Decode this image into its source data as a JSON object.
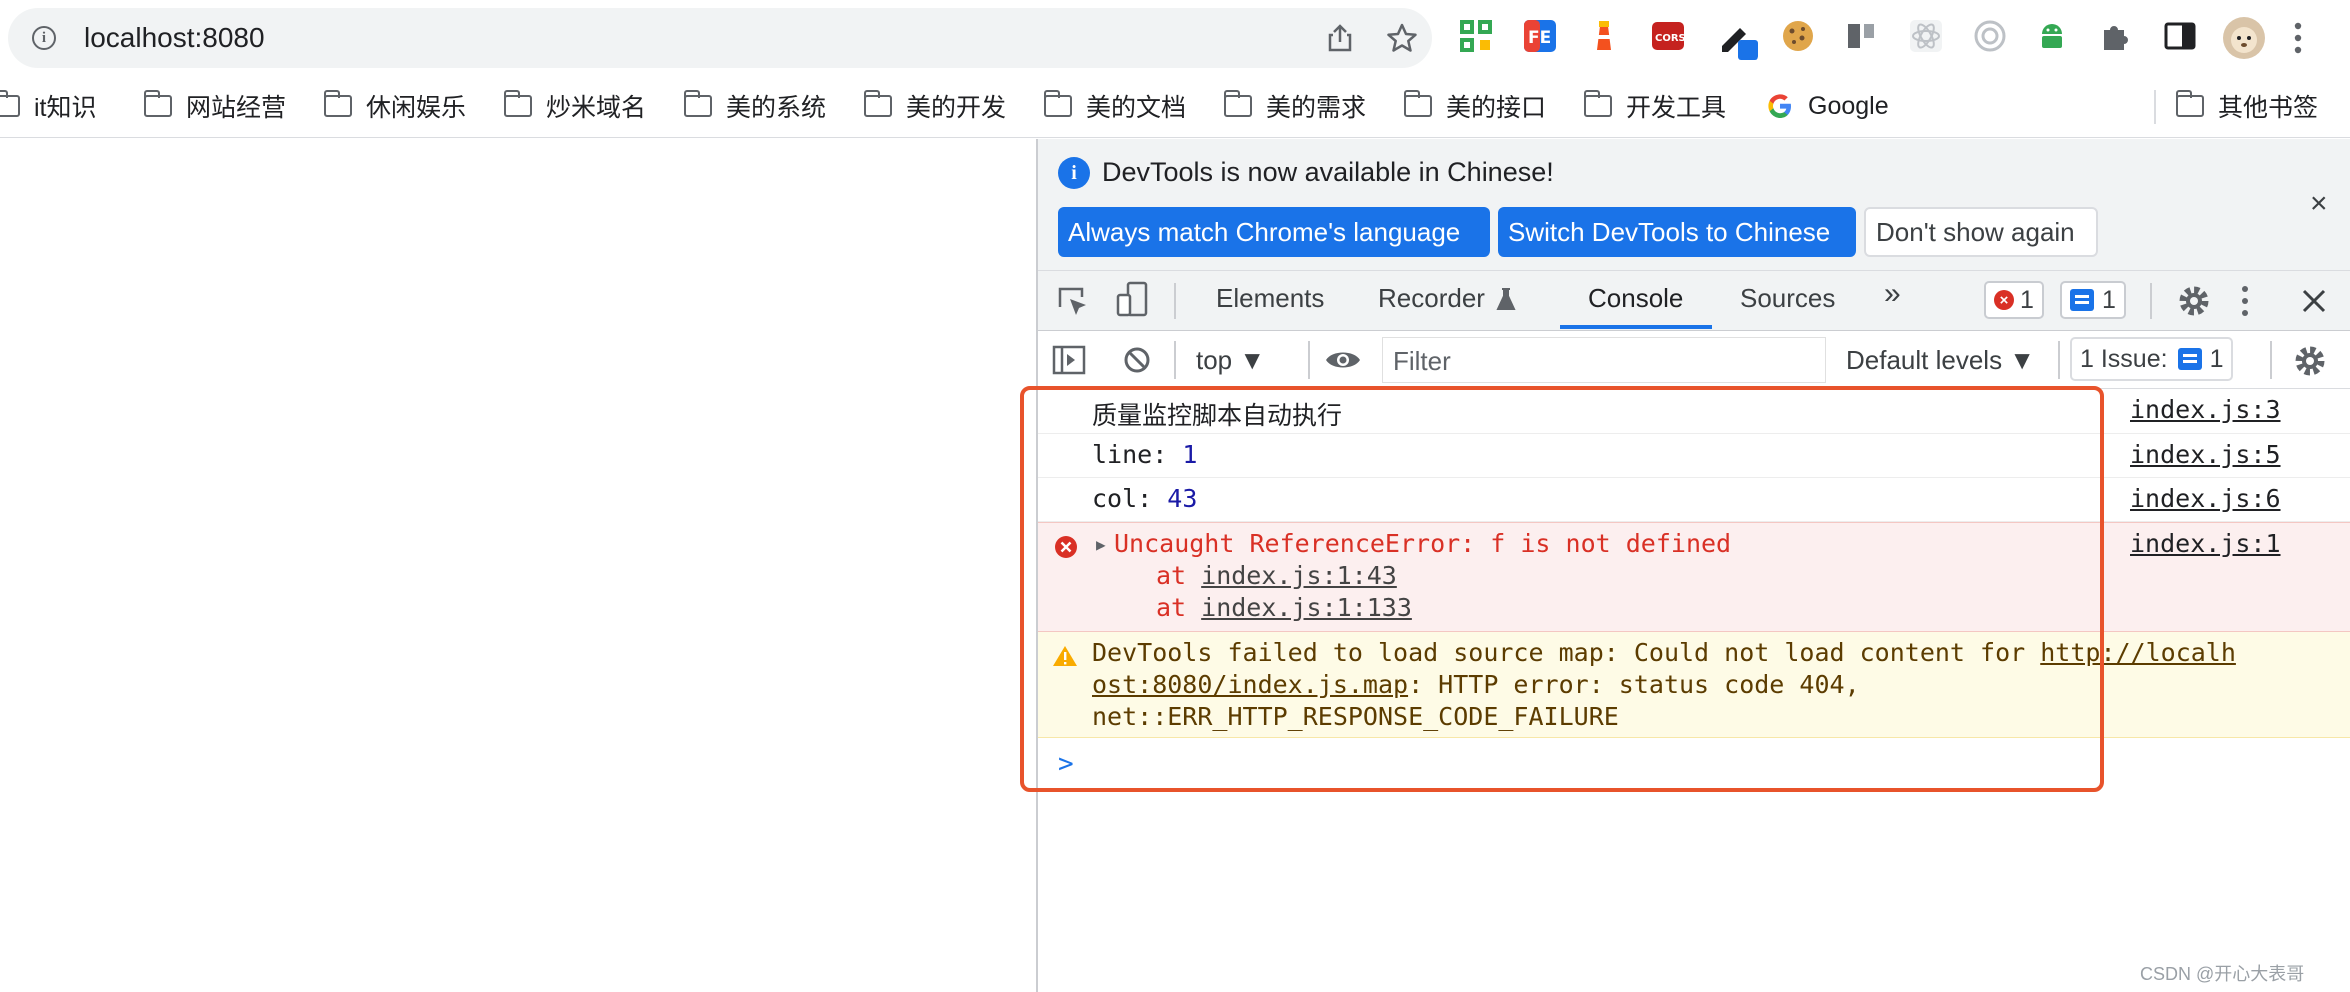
{
  "browser": {
    "url": "localhost:8080",
    "bookmarks": [
      "it知识",
      "网站经营",
      "休闲娱乐",
      "炒米域名",
      "美的系统",
      "美的开发",
      "美的文档",
      "美的需求",
      "美的接口",
      "开发工具",
      "Google"
    ],
    "other_bookmarks": "其他书签"
  },
  "devtools": {
    "infobar": {
      "message": "DevTools is now available in Chinese!",
      "btn_match": "Always match Chrome's language",
      "btn_switch": "Switch DevTools to Chinese",
      "btn_dont_show": "Don't show again",
      "close": "×"
    },
    "tabs": {
      "elements": "Elements",
      "recorder": "Recorder",
      "console": "Console",
      "sources": "Sources",
      "more": "»"
    },
    "counts": {
      "errors": "1",
      "messages": "1"
    },
    "toolbar": {
      "context": "top ▼",
      "filter_placeholder": "Filter",
      "levels": "Default levels ▼",
      "issues_label": "1 Issue:",
      "issues_count": "1"
    },
    "console": {
      "rows": [
        {
          "text": "质量监控脚本自动执行",
          "source": "index.js:3"
        },
        {
          "label": "line: ",
          "value": "1",
          "source": "index.js:5"
        },
        {
          "label": "col: ",
          "value": "43",
          "source": "index.js:6"
        }
      ],
      "error": {
        "message": "Uncaught ReferenceError: f is not defined",
        "source": "index.js:1",
        "stack_prefix": "at ",
        "stack": [
          "index.js:1:43",
          "index.js:1:133"
        ]
      },
      "warning": {
        "prefix": "DevTools failed to load source map: Could not load content for ",
        "url_part1": "http://localh",
        "url_part2": "ost:8080/index.js.map",
        "suffix": ": HTTP error: status code 404,",
        "line3": "net::ERR_HTTP_RESPONSE_CODE_FAILURE"
      },
      "prompt": ">"
    }
  },
  "watermark": "CSDN @开心大表哥",
  "colors": {
    "accent": "#1a73e8",
    "error": "#d93025",
    "highlight": "#e8532b"
  }
}
